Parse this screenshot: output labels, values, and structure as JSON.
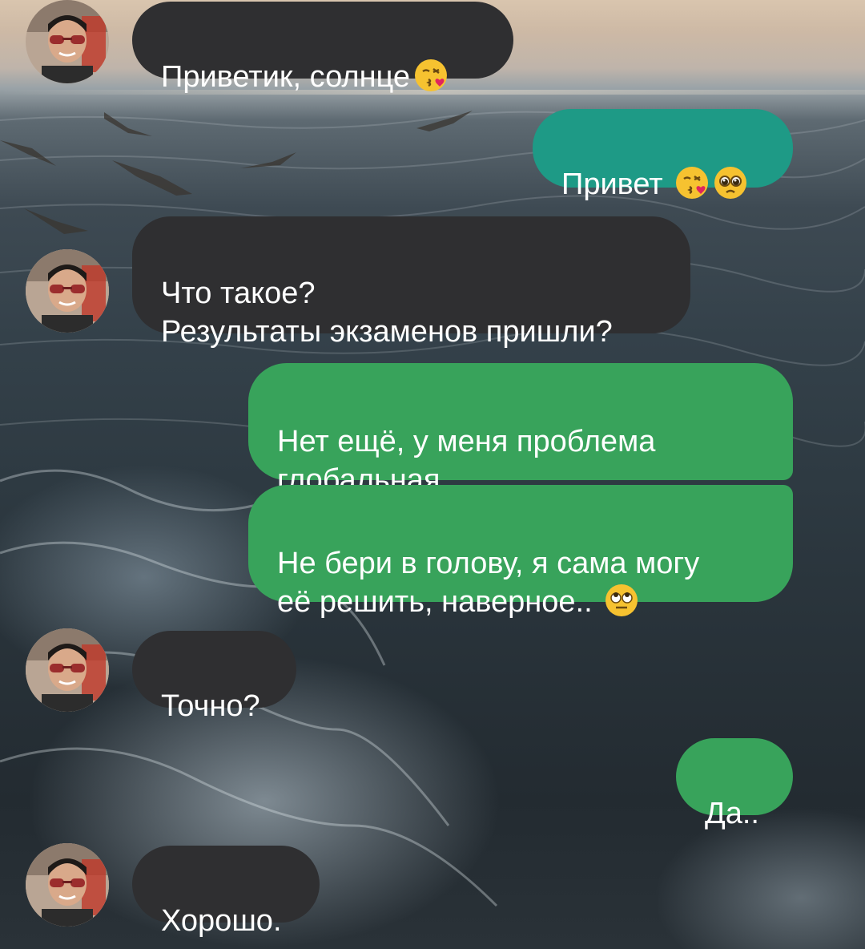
{
  "messages": [
    {
      "id": "m1",
      "direction": "incoming",
      "text": "Приветик, солнце",
      "emoji": [
        "kissing-face-with-heart-emoji"
      ]
    },
    {
      "id": "m2",
      "direction": "outgoing",
      "text": "Привет",
      "emoji": [
        "kissing-face-with-heart-emoji",
        "pleading-face-emoji"
      ]
    },
    {
      "id": "m3",
      "direction": "incoming",
      "text": "Что такое?\nРезультаты экзаменов пришли?",
      "emoji": []
    },
    {
      "id": "m4",
      "direction": "outgoing",
      "text": "Нет ещё, у меня проблема\nглобальная...",
      "emoji": []
    },
    {
      "id": "m5",
      "direction": "outgoing",
      "text": "Не бери в голову, я сама могу\nеё решить, наверное..",
      "emoji": [
        "face-with-rolling-eyes-emoji"
      ]
    },
    {
      "id": "m6",
      "direction": "incoming",
      "text": "Точно?",
      "emoji": []
    },
    {
      "id": "m7",
      "direction": "outgoing",
      "text": "Да..",
      "emoji": []
    },
    {
      "id": "m8",
      "direction": "incoming",
      "text": "Хорошо.",
      "emoji": []
    }
  ],
  "colors": {
    "incoming_bubble": "#2f2f31",
    "outgoing_teal": "#1e9a86",
    "outgoing_green": "#38a35b",
    "text": "#ffffff"
  }
}
